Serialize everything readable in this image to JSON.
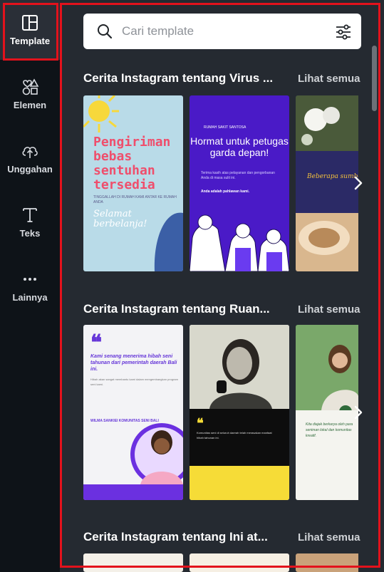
{
  "rail": {
    "items": [
      {
        "label": "Template",
        "icon": "template-icon",
        "active": true
      },
      {
        "label": "Elemen",
        "icon": "elements-icon"
      },
      {
        "label": "Unggahan",
        "icon": "upload-cloud-icon"
      },
      {
        "label": "Teks",
        "icon": "text-icon"
      },
      {
        "label": "Lainnya",
        "icon": "more-icon"
      }
    ]
  },
  "search": {
    "placeholder": "Cari template"
  },
  "sections": [
    {
      "title": "Cerita Instagram tentang Virus ...",
      "see_all": "Lihat semua",
      "cards": [
        {
          "heading": "Pengiriman bebas sentuhan tersedia",
          "small": "TINGGALLAH DI RUMAH KAMI ANTAR KE RUMAH ANDA",
          "script": "Selamat berbelanja!"
        },
        {
          "tiny": "RUMAH SAKIT SANTOSA",
          "heading": "Hormat untuk petugas garda depan!",
          "para": "Terima kasih atas pelayanan dan pengorbanan Anda di masa sulit ini.",
          "bold": "Anda adalah pahlawan kami."
        },
        {
          "text": "Beberapa sumber meringankan pikiran"
        }
      ]
    },
    {
      "title": "Cerita Instagram tentang Ruan...",
      "see_all": "Lihat semua",
      "cards": [
        {
          "quote": "❝",
          "heading": "Kami senang menerima hibah seni tahunan dari pemerintah daerah Bali ini.",
          "para": "Hibah akan sangat membantu kami dalam mengembangkan program seni kami.",
          "name": "WILMA SANKIEI KOMUNITAS SENI BALI"
        },
        {
          "quote": "❝",
          "para": "Komunitas seni di seluruh daerah telah merasakan manfaat hibah tahunan ini."
        },
        {
          "para": "Kita diajak berkarya oleh para seniman lokal dan komunitas kreatif."
        }
      ]
    },
    {
      "title": "Cerita Instagram tentang Ini at...",
      "see_all": "Lihat semua",
      "cards": []
    }
  ]
}
